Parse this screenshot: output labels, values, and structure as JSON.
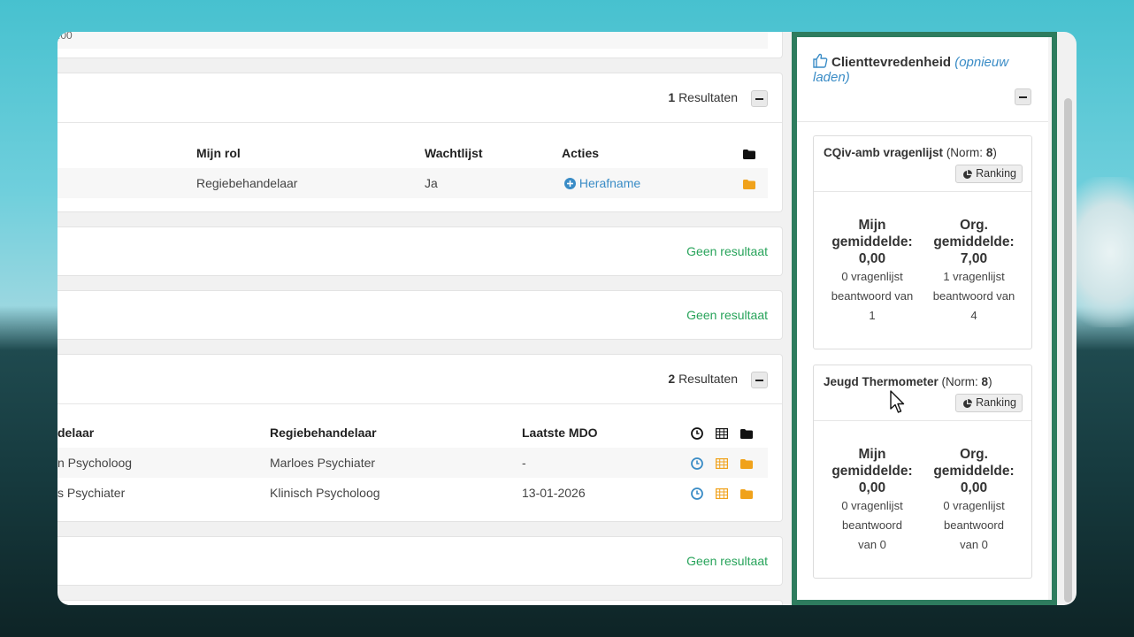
{
  "top_snippet": ":00",
  "panel_wachtlijst": {
    "count_num": "1",
    "count_label": "Resultaten",
    "headers": {
      "mijn_rol": "Mijn rol",
      "wachtlijst": "Wachtlijst",
      "acties": "Acties"
    },
    "row": {
      "mijn_rol": "Regiebehandelaar",
      "wachtlijst": "Ja",
      "actie": "Herafname"
    }
  },
  "panel_empty_1": {
    "label": "Geen resultaat"
  },
  "panel_empty_2": {
    "label": "Geen resultaat"
  },
  "panel_mdo": {
    "count_num": "2",
    "count_label": "Resultaten",
    "headers": {
      "col1": "delaar",
      "col2": "Regiebehandelaar",
      "col3": "Laatste MDO"
    },
    "rows": [
      {
        "col1": "n Psycholoog",
        "col2": "Marloes Psychiater",
        "col3": "-"
      },
      {
        "col1": "s Psychiater",
        "col2": "Klinisch Psycholoog",
        "col3": "13-01-2026"
      }
    ]
  },
  "panel_empty_3": {
    "label": "Geen resultaat"
  },
  "widget": {
    "title": "Clienttevredenheid",
    "reload": "(opnieuw laden)",
    "cards": [
      {
        "name": "CQiv-amb vragenlijst",
        "norm_prefix": "(Norm: ",
        "norm": "8",
        "norm_suffix": ")",
        "ranking": "Ranking",
        "mine": {
          "l1": "Mijn",
          "l2": "gemiddelde:",
          "l3": "0,00",
          "s1": "0 vragenlijst",
          "s2": "beantwoord van",
          "s3": "1"
        },
        "org": {
          "l1": "Org.",
          "l2": "gemiddelde:",
          "l3": "7,00",
          "s1": "1 vragenlijst",
          "s2": "beantwoord van",
          "s3": "4"
        }
      },
      {
        "name": "Jeugd Thermometer",
        "norm_prefix": "(Norm: ",
        "norm": "8",
        "norm_suffix": ")",
        "ranking": "Ranking",
        "mine": {
          "l1": "Mijn",
          "l2": "gemiddelde:",
          "l3": "0,00",
          "s1": "0 vragenlijst",
          "s2": "beantwoord",
          "s3": "van 0"
        },
        "org": {
          "l1": "Org.",
          "l2": "gemiddelde:",
          "l3": "0,00",
          "s1": "0 vragenlijst",
          "s2": "beantwoord",
          "s3": "van 0"
        }
      }
    ]
  },
  "colors": {
    "accent_green": "#2e7c5e",
    "link_blue": "#3a8cc6",
    "success_green": "#27a35a",
    "folder_orange": "#f0a21b"
  }
}
